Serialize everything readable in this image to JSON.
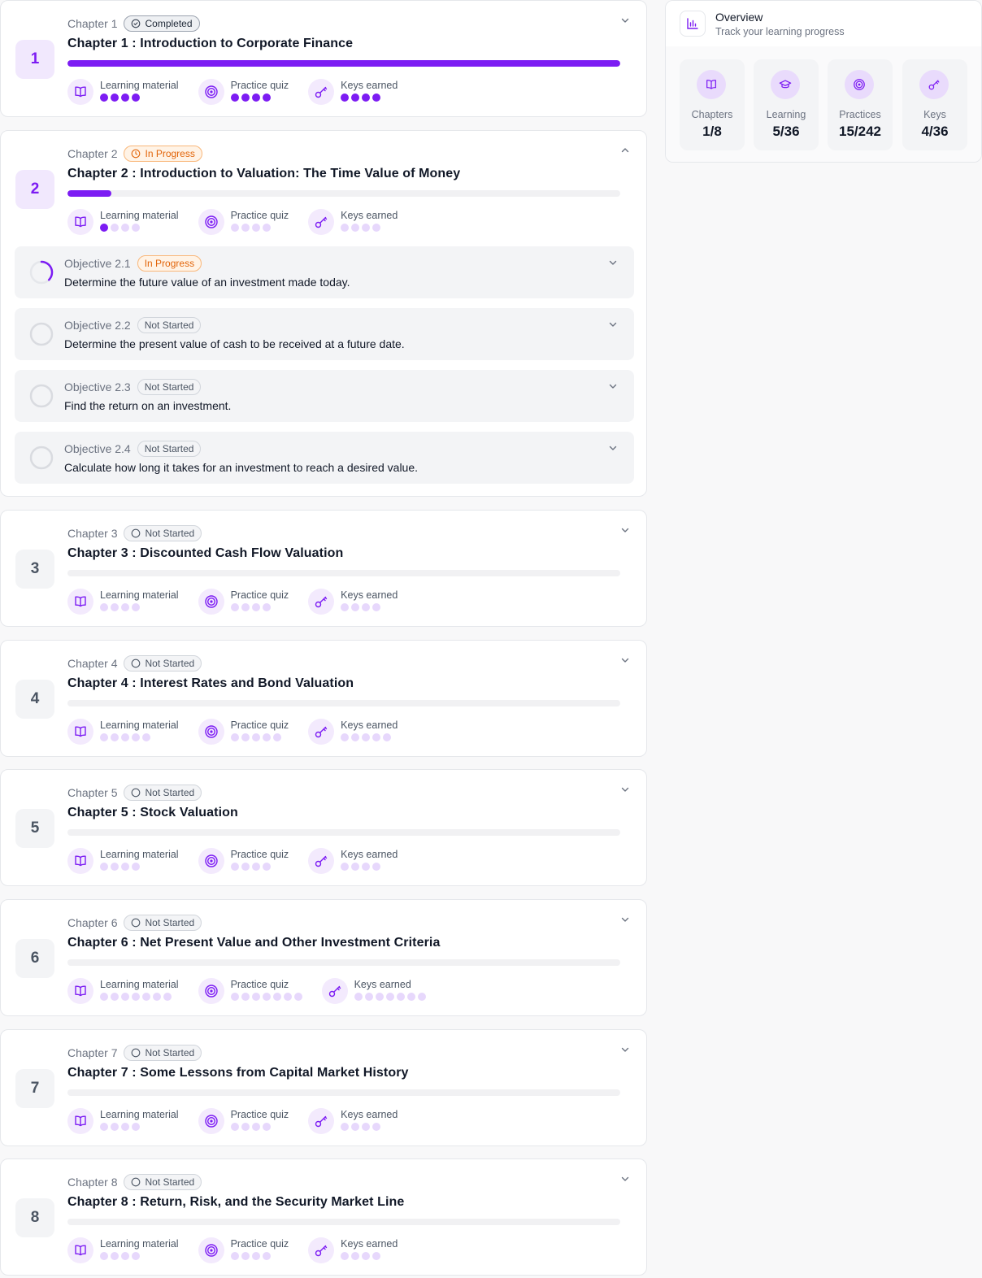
{
  "accent": "#7c1cf3",
  "overview": {
    "title": "Overview",
    "subtitle": "Track your learning progress",
    "icon": "bar-chart-icon",
    "tiles": [
      {
        "label": "Chapters",
        "value": "1/8",
        "icon": "book-open-icon"
      },
      {
        "label": "Learning",
        "value": "5/36",
        "icon": "graduation-cap-icon"
      },
      {
        "label": "Practices",
        "value": "15/242",
        "icon": "target-icon"
      },
      {
        "label": "Keys",
        "value": "4/36",
        "icon": "key-icon"
      }
    ]
  },
  "stat_labels": {
    "learning": "Learning material",
    "practice": "Practice quiz",
    "keys": "Keys earned"
  },
  "chapters": [
    {
      "num": "1",
      "label": "Chapter 1",
      "status": "Completed",
      "title": "Chapter 1 : Introduction to Corporate Finance",
      "progress": 1.0,
      "learning": {
        "total": 4,
        "done": 4
      },
      "practice": {
        "total": 4,
        "done": 4
      },
      "keys": {
        "total": 4,
        "done": 4
      }
    },
    {
      "num": "2",
      "label": "Chapter 2",
      "status": "In Progress",
      "title": "Chapter 2 : Introduction to Valuation: The Time Value of Money",
      "progress": 0.08,
      "expanded": true,
      "learning": {
        "total": 4,
        "done": 1
      },
      "practice": {
        "total": 4,
        "done": 0
      },
      "keys": {
        "total": 4,
        "done": 0
      },
      "objectives": [
        {
          "label": "Objective 2.1",
          "status": "In Progress",
          "text": "Determine the future value of an investment made today."
        },
        {
          "label": "Objective 2.2",
          "status": "Not Started",
          "text": "Determine the present value of cash to be received at a future date."
        },
        {
          "label": "Objective 2.3",
          "status": "Not Started",
          "text": "Find the return on an investment."
        },
        {
          "label": "Objective 2.4",
          "status": "Not Started",
          "text": "Calculate how long it takes for an investment to reach a desired value."
        }
      ]
    },
    {
      "num": "3",
      "label": "Chapter 3",
      "status": "Not Started",
      "title": "Chapter 3 : Discounted Cash Flow Valuation",
      "progress": 0,
      "learning": {
        "total": 4,
        "done": 0
      },
      "practice": {
        "total": 4,
        "done": 0
      },
      "keys": {
        "total": 4,
        "done": 0
      }
    },
    {
      "num": "4",
      "label": "Chapter 4",
      "status": "Not Started",
      "title": "Chapter 4 : Interest Rates and Bond Valuation",
      "progress": 0,
      "learning": {
        "total": 5,
        "done": 0
      },
      "practice": {
        "total": 5,
        "done": 0
      },
      "keys": {
        "total": 5,
        "done": 0
      }
    },
    {
      "num": "5",
      "label": "Chapter 5",
      "status": "Not Started",
      "title": "Chapter 5 : Stock Valuation",
      "progress": 0,
      "learning": {
        "total": 4,
        "done": 0
      },
      "practice": {
        "total": 4,
        "done": 0
      },
      "keys": {
        "total": 4,
        "done": 0
      }
    },
    {
      "num": "6",
      "label": "Chapter 6",
      "status": "Not Started",
      "title": "Chapter 6 : Net Present Value and Other Investment Criteria",
      "progress": 0,
      "learning": {
        "total": 7,
        "done": 0
      },
      "practice": {
        "total": 7,
        "done": 0
      },
      "keys": {
        "total": 7,
        "done": 0
      }
    },
    {
      "num": "7",
      "label": "Chapter 7",
      "status": "Not Started",
      "title": "Chapter 7 : Some Lessons from Capital Market History",
      "progress": 0,
      "learning": {
        "total": 4,
        "done": 0
      },
      "practice": {
        "total": 4,
        "done": 0
      },
      "keys": {
        "total": 4,
        "done": 0
      }
    },
    {
      "num": "8",
      "label": "Chapter 8",
      "status": "Not Started",
      "title": "Chapter 8 : Return, Risk, and the Security Market Line",
      "progress": 0,
      "learning": {
        "total": 4,
        "done": 0
      },
      "practice": {
        "total": 4,
        "done": 0
      },
      "keys": {
        "total": 4,
        "done": 0
      }
    }
  ]
}
